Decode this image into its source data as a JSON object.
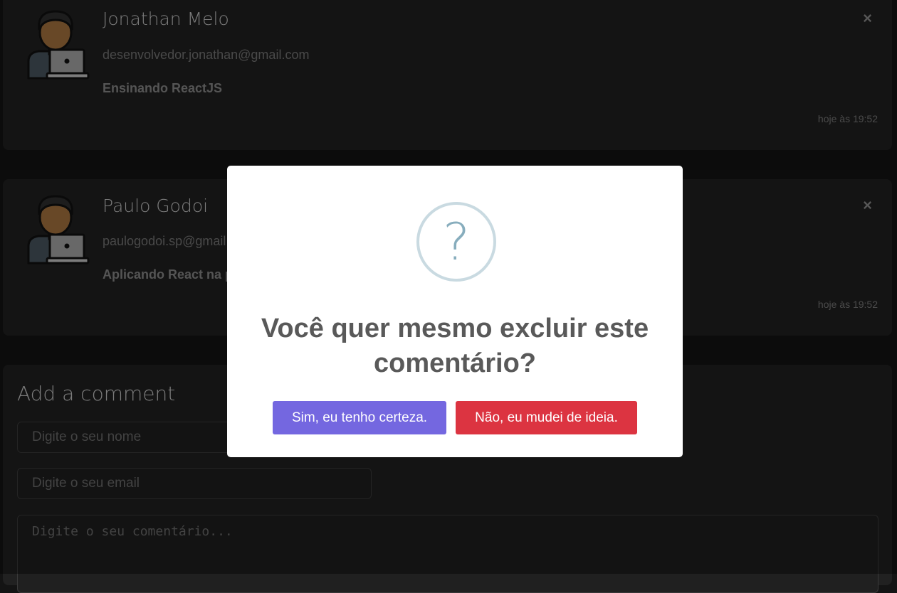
{
  "comments": [
    {
      "name": "Jonathan Melo",
      "email": "desenvolvedor.jonathan@gmail.com",
      "text": "Ensinando ReactJS",
      "time": "hoje às 19:52",
      "close_icon": "×"
    },
    {
      "name": "Paulo Godoi",
      "email": "paulogodoi.sp@gmail.com",
      "text": "Aplicando React na prática",
      "time": "hoje às 19:52",
      "close_icon": "×"
    }
  ],
  "form": {
    "title": "Add a comment",
    "name_placeholder": "Digite o seu nome",
    "email_placeholder": "Digite o seu email",
    "comment_placeholder": "Digite o seu comentário..."
  },
  "modal": {
    "icon": "?",
    "title": "Você quer mesmo excluir este comentário?",
    "confirm_label": "Sim, eu tenho certeza.",
    "cancel_label": "Não, eu mudei de ideia."
  },
  "colors": {
    "background": "#141414",
    "card": "#212121",
    "confirm": "#7467e0",
    "cancel": "#dc3441",
    "icon_ring": "#c9dae1"
  }
}
